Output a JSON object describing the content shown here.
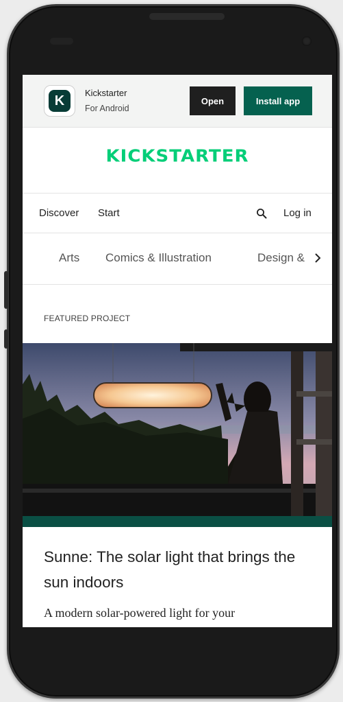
{
  "app_banner": {
    "app_name": "Kickstarter",
    "platform": "For Android",
    "logo_letter": "K",
    "open_label": "Open",
    "install_label": "Install app"
  },
  "header": {
    "brand": "KICKSTARTER",
    "brand_color": "#05ce78"
  },
  "nav": {
    "discover": "Discover",
    "start": "Start",
    "login": "Log in"
  },
  "categories": [
    "Arts",
    "Comics & Illustration",
    "Design &"
  ],
  "featured": {
    "label": "FEATURED PROJECT",
    "title": "Sunne: The solar light that brings the sun indoors",
    "blurb": "A modern solar-powered light for your"
  },
  "colors": {
    "open_button": "#1f1f1f",
    "install_button": "#05614f",
    "hero_bar": "#0a4f44"
  }
}
